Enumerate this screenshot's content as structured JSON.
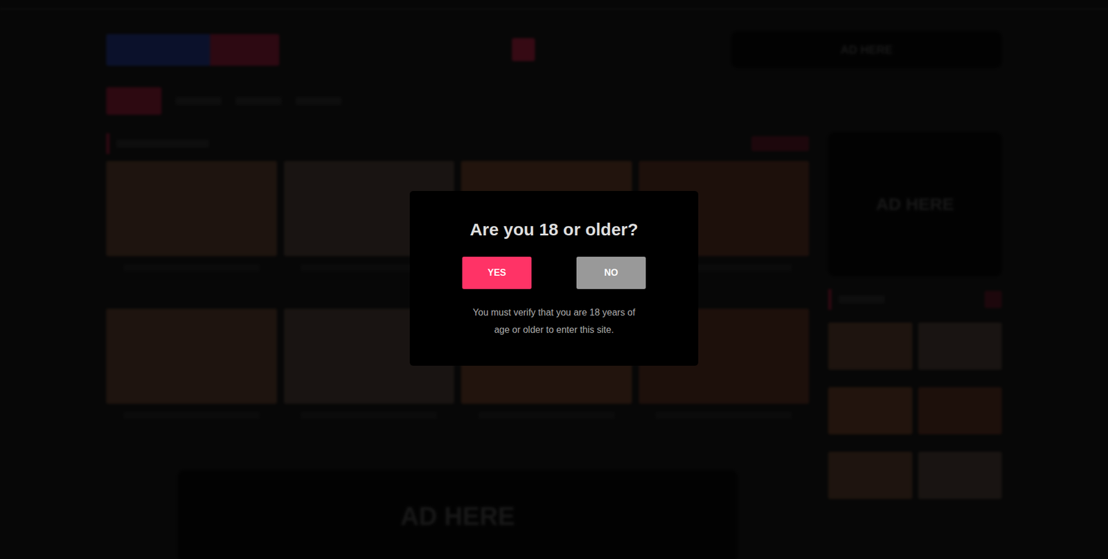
{
  "modal": {
    "title": "Are you 18 or older?",
    "buttons": [
      {
        "label": "YES",
        "primary": true
      },
      {
        "label": "NO",
        "primary": false
      }
    ],
    "message": "You must verify that you are 18 years of age or older to enter this site."
  },
  "ads": [
    {
      "label": "AD HERE"
    },
    {
      "label": "AD HERE"
    },
    {
      "label": "AD HERE"
    }
  ]
}
